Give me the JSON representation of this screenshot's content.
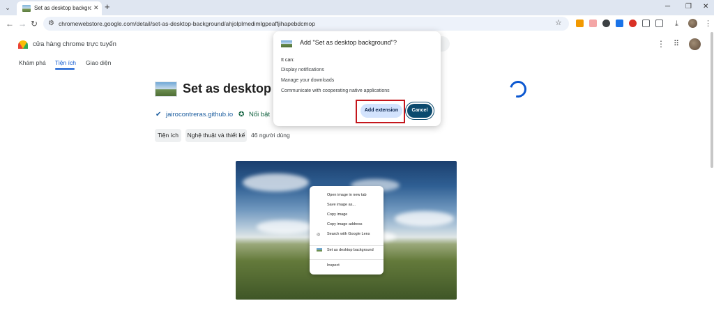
{
  "browser": {
    "tab_title": "Set as desktop background - C",
    "tab_close": "✕",
    "new_tab": "+",
    "tab_list": "⌄",
    "window_minimize": "─",
    "window_restore": "❐",
    "window_close": "✕",
    "url": "chromewebstore.google.com/detail/set-as-desktop-background/ahjolplmedimlgpeaffjihapebdcmop",
    "icons": {
      "back": "←",
      "forward": "→",
      "reload": "↻",
      "site_info": "⚙",
      "bookmark": "☆",
      "download": "⤓",
      "menu": "⋮"
    }
  },
  "store": {
    "name": "cửa hàng chrome trực tuyến",
    "nav": {
      "discover": "Khám phá",
      "extensions": "Tiện ích",
      "themes": "Giao diện"
    },
    "menu_icon": "⋮",
    "apps_icon": "⠿"
  },
  "extension": {
    "title": "Set as desktop background",
    "publisher": "jairocontreras.github.io",
    "featured": "Nổi bật",
    "chips": {
      "category": "Tiện ích",
      "subcategory": "Nghệ thuật và thiết kế"
    },
    "users": "46 người dùng"
  },
  "dialog": {
    "title": "Add \"Set as desktop background\"?",
    "it_can": "It can:",
    "permissions": [
      "Display notifications",
      "Manage your downloads",
      "Communicate with cooperating native applications"
    ],
    "add_button": "Add extension",
    "cancel_button": "Cancel"
  },
  "context_menu": {
    "items": [
      "Open image in new tab",
      "Save image as...",
      "Copy image",
      "Copy image address",
      "Search with Google Lens",
      "Set as desktop background",
      "Inspect"
    ]
  },
  "colors": {
    "accent": "#0b57d0",
    "publisher": "#1a5c9e",
    "featured": "#0b5e3a",
    "highlight": "#c4161c",
    "cancel_bg": "#0b4a6e",
    "add_bg": "#d3e3fd"
  }
}
